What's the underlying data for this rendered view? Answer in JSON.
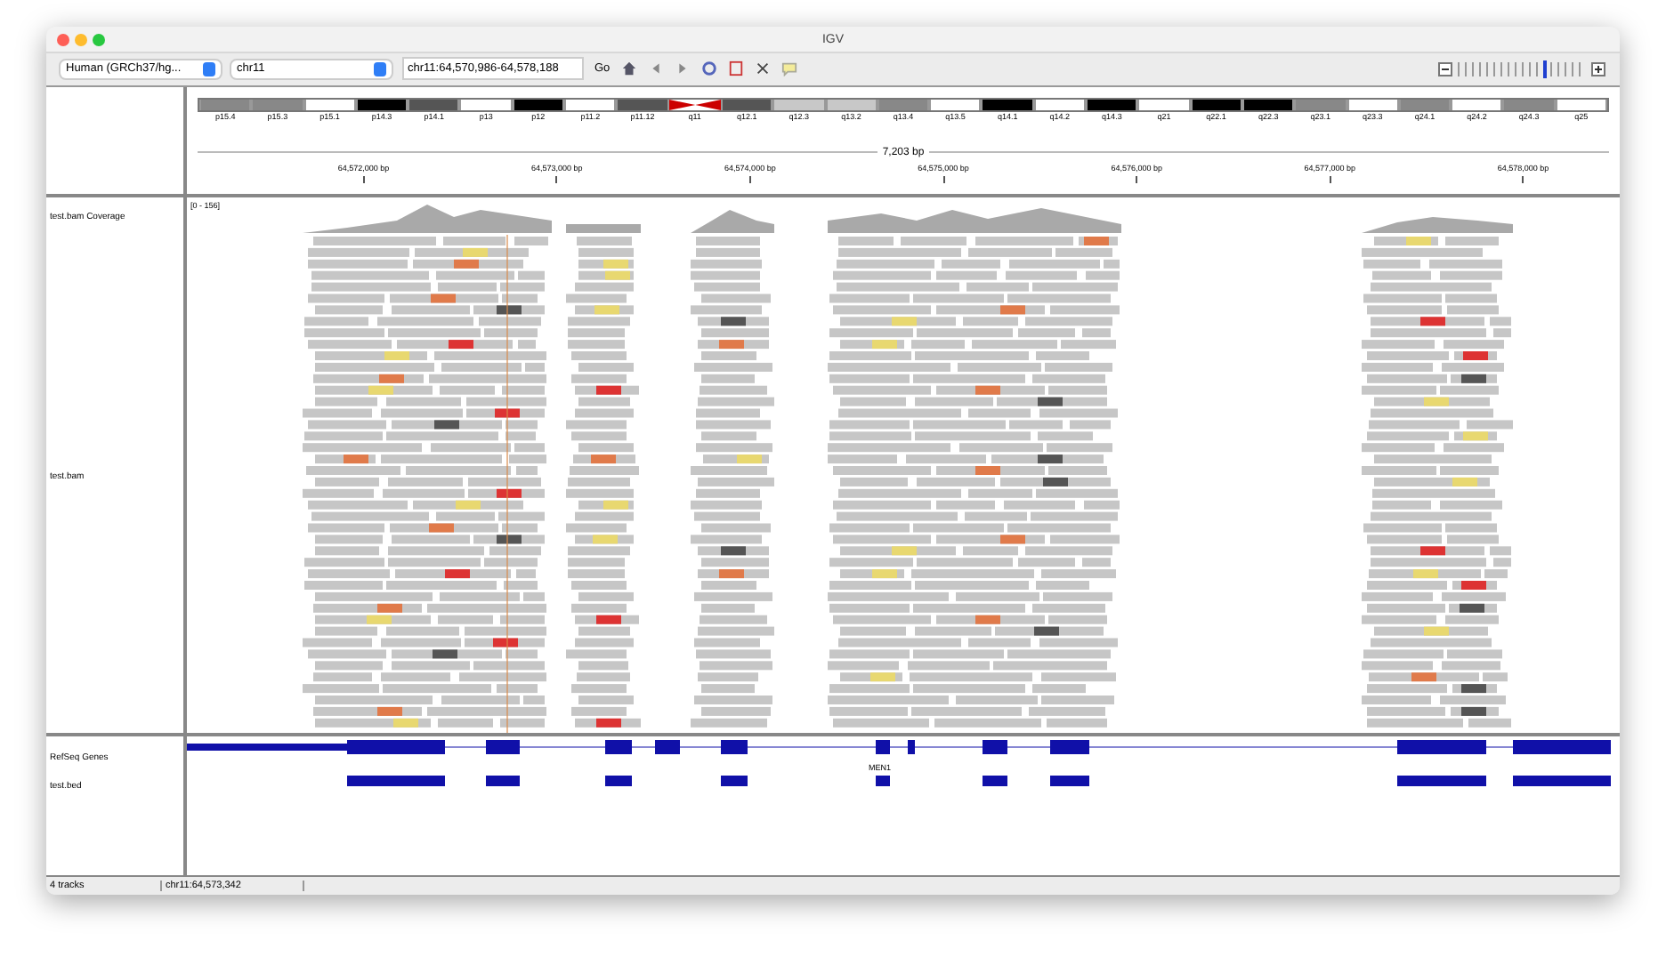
{
  "window": {
    "title": "IGV"
  },
  "toolbar": {
    "genome": "Human (GRCh37/hg...",
    "chromosome": "chr11",
    "locus": "chr11:64,570,986-64,578,188",
    "go": "Go"
  },
  "zoom": {
    "level": 0.66
  },
  "ideogram": [
    {
      "label": "p15.4",
      "kind": "band",
      "color": "#888888"
    },
    {
      "label": "p15.3",
      "kind": "band",
      "color": "#888888"
    },
    {
      "label": "p15.1",
      "kind": "band",
      "color": "#ffffff"
    },
    {
      "label": "p14.3",
      "kind": "band",
      "color": "#000000"
    },
    {
      "label": "p14.1",
      "kind": "band",
      "color": "#555555"
    },
    {
      "label": "p13",
      "kind": "band",
      "color": "#ffffff"
    },
    {
      "label": "p12",
      "kind": "band",
      "color": "#000000"
    },
    {
      "label": "p11.2",
      "kind": "band",
      "color": "#ffffff"
    },
    {
      "label": "p11.12",
      "kind": "band",
      "color": "#555555"
    },
    {
      "label": "q11",
      "kind": "centromere",
      "color": "#cc0000"
    },
    {
      "label": "q12.1",
      "kind": "band",
      "color": "#555555"
    },
    {
      "label": "q12.3",
      "kind": "band",
      "color": "#c8c8c8"
    },
    {
      "label": "q13.2",
      "kind": "band",
      "color": "#c8c8c8"
    },
    {
      "label": "q13.4",
      "kind": "band",
      "color": "#888888"
    },
    {
      "label": "q13.5",
      "kind": "band",
      "color": "#ffffff"
    },
    {
      "label": "q14.1",
      "kind": "band",
      "color": "#000000"
    },
    {
      "label": "q14.2",
      "kind": "band",
      "color": "#ffffff"
    },
    {
      "label": "q14.3",
      "kind": "band",
      "color": "#000000"
    },
    {
      "label": "q21",
      "kind": "band",
      "color": "#ffffff"
    },
    {
      "label": "q22.1",
      "kind": "band",
      "color": "#000000"
    },
    {
      "label": "q22.3",
      "kind": "band",
      "color": "#000000"
    },
    {
      "label": "q23.1",
      "kind": "band",
      "color": "#888888"
    },
    {
      "label": "q23.3",
      "kind": "band",
      "color": "#ffffff"
    },
    {
      "label": "q24.1",
      "kind": "band",
      "color": "#888888"
    },
    {
      "label": "q24.2",
      "kind": "band",
      "color": "#ffffff"
    },
    {
      "label": "q24.3",
      "kind": "band",
      "color": "#888888"
    },
    {
      "label": "q25",
      "kind": "band",
      "color": "#ffffff"
    }
  ],
  "ruler": {
    "span": "7,203 bp",
    "ticks": [
      "64,572,000 bp",
      "64,573,000 bp",
      "64,574,000 bp",
      "64,575,000 bp",
      "64,576,000 bp",
      "64,577,000 bp",
      "64,578,000 bp"
    ]
  },
  "data_tracks": [
    {
      "name": "test.bam Coverage",
      "kind": "coverage",
      "range": "[0 - 156]"
    },
    {
      "name": "test.bam",
      "kind": "alignment"
    }
  ],
  "feature_tracks": [
    {
      "name": "RefSeq Genes",
      "kind": "gene",
      "label": "MEN1"
    },
    {
      "name": "test.bed",
      "kind": "bed"
    }
  ],
  "status_bar": {
    "tracks": "4 tracks",
    "position": "chr11:64,573,342"
  }
}
